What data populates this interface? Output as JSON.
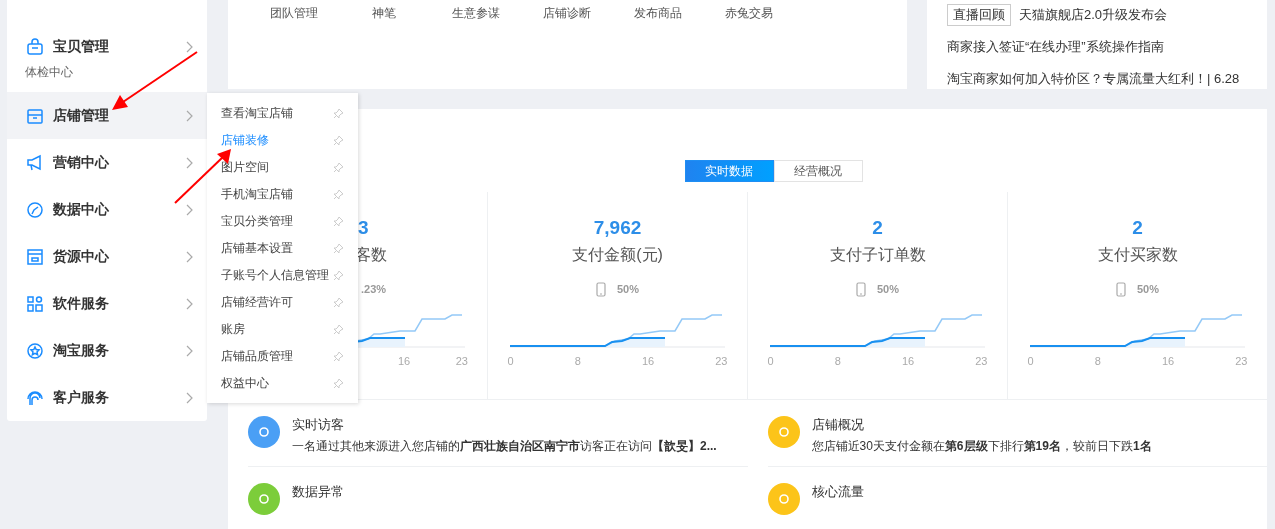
{
  "sidebar": {
    "items": [
      {
        "label": "宝贝管理",
        "sub": "体检中心",
        "hovered": false
      },
      {
        "label": "店铺管理",
        "hovered": true
      },
      {
        "label": "营销中心",
        "hovered": false
      },
      {
        "label": "数据中心",
        "hovered": false
      },
      {
        "label": "货源中心",
        "hovered": false
      },
      {
        "label": "软件服务",
        "hovered": false
      },
      {
        "label": "淘宝服务",
        "hovered": false
      },
      {
        "label": "客户服务",
        "hovered": false
      }
    ]
  },
  "submenu": {
    "items": [
      {
        "label": "查看淘宝店铺",
        "selected": false
      },
      {
        "label": "店铺装修",
        "selected": true
      },
      {
        "label": "图片空间",
        "selected": false
      },
      {
        "label": "手机淘宝店铺",
        "selected": false
      },
      {
        "label": "宝贝分类管理",
        "selected": false
      },
      {
        "label": "店铺基本设置",
        "selected": false
      },
      {
        "label": "子账号个人信息管理",
        "selected": false
      },
      {
        "label": "店铺经营许可",
        "selected": false
      },
      {
        "label": "账房",
        "selected": false
      },
      {
        "label": "店铺品质管理",
        "selected": false
      },
      {
        "label": "权益中心",
        "selected": false
      }
    ]
  },
  "quick_links": [
    "团队管理",
    "神笔",
    "生意参谋",
    "店铺诊断",
    "发布商品",
    "赤兔交易"
  ],
  "news": {
    "tag": "直播回顾",
    "items": [
      "天猫旗舰店2.0升级发布会",
      "商家接入签证“在线办理”系统操作指南",
      "淘宝商家如何加入特价区？专属流量大红利！| 6.28"
    ]
  },
  "data_tabs": [
    {
      "label": "实时数据",
      "selected": true
    },
    {
      "label": "经营概况",
      "selected": false
    }
  ],
  "stats": [
    {
      "value": "3",
      "label": "客数",
      "share": ".23%",
      "xticks": [
        "16",
        "23"
      ]
    },
    {
      "value": "7,962",
      "label": "支付金额(元)",
      "share": "50%",
      "xticks": [
        "0",
        "8",
        "16",
        "23"
      ]
    },
    {
      "value": "2",
      "label": "支付子订单数",
      "share": "50%",
      "xticks": [
        "0",
        "8",
        "16",
        "23"
      ]
    },
    {
      "value": "2",
      "label": "支付买家数",
      "share": "50%",
      "xticks": [
        "0",
        "8",
        "16",
        "23"
      ]
    }
  ],
  "notices": [
    {
      "title": "实时访客",
      "text": "一名通过其他来源进入您店铺的**广西壮族自治区南宁市**访客正在访问**【歆旻】2...**",
      "color": "#4a9ff5"
    },
    {
      "title": "店铺概况",
      "text": "您店铺近30天支付金额在**第6层级**下排行**第19名**，较前日下跌**1名**",
      "color": "#fcc419"
    },
    {
      "title": "数据异常",
      "color": "#7ccd3a"
    },
    {
      "title": "核心流量",
      "color": "#fcc419"
    }
  ]
}
